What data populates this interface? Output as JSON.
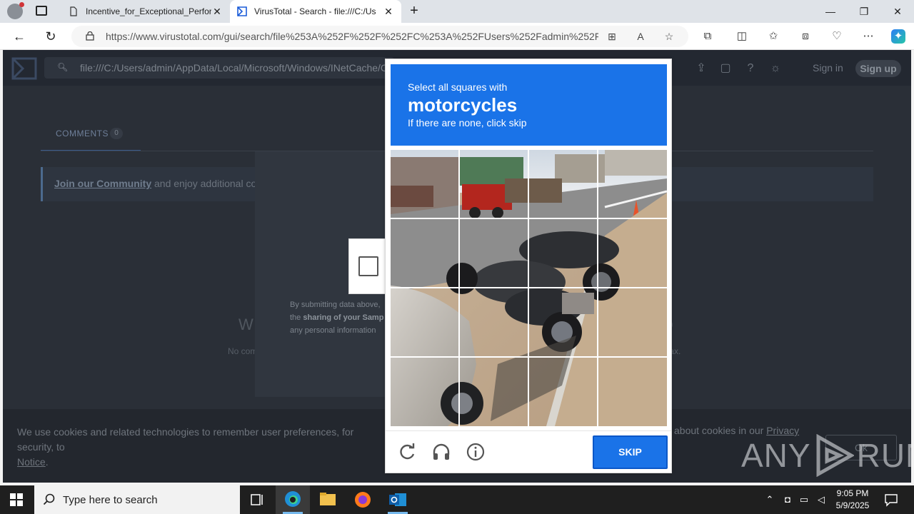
{
  "browser": {
    "tabs": [
      {
        "title": "Incentive_for_Exceptional_Perfor",
        "close": "✕"
      },
      {
        "title": "VirusTotal - Search - file:///C:/Us",
        "close": "✕"
      }
    ],
    "new_tab": "+",
    "window_controls": {
      "minimize": "—",
      "maximize": "❐",
      "close": "✕"
    },
    "url": "https://www.virustotal.com/gui/search/file%253A%252F%252F%252FC%253A%252FUsers%252Fadmin%252F..."
  },
  "virustotal": {
    "search_query": "file:///C:/Users/admin/AppData/Local/Microsoft/Windows/INetCache/Co",
    "sign_in": "Sign in",
    "sign_up": "Sign up",
    "comments_tab": {
      "label": "COMMENTS",
      "count": "0"
    },
    "community": {
      "link": "Join our Community",
      "text": " and enjoy additional com"
    },
    "bg_heading": "W",
    "bg_sub": "No com",
    "bg_tail": "tax."
  },
  "captcha_notice": {
    "line1": "By submitting data above,",
    "line2_pre": "the ",
    "line2_bold": "sharing of your Samp",
    "line3": "any personal information"
  },
  "challenge": {
    "prompt_line1": "Select all squares with",
    "prompt_target": "motorcycles",
    "prompt_line3": "If there are none, click skip",
    "skip_label": "SKIP",
    "grid_rows": 4,
    "grid_cols": 4
  },
  "cookie_bar": {
    "text_left": "We use cookies and related technologies to remember user preferences, for security, to",
    "text_left2": "Notice",
    "text_right_pre": "about cookies in our ",
    "text_right_link": "Privacy",
    "ok_label": "Ok"
  },
  "watermark": {
    "left": "ANY",
    "right": "RUN"
  },
  "taskbar": {
    "search_placeholder": "Type here to search",
    "time": "9:05 PM",
    "date": "5/9/2025"
  }
}
